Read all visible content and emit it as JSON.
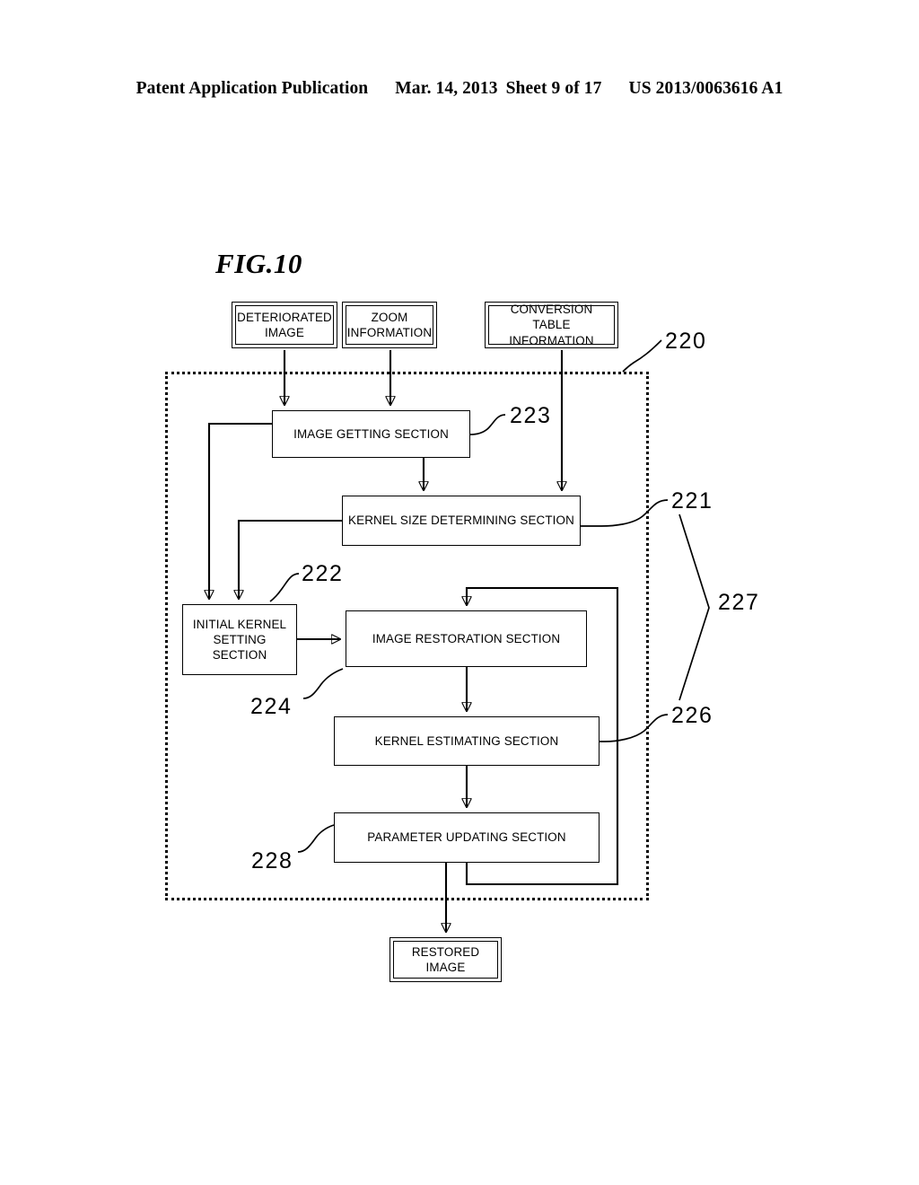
{
  "header": {
    "publication": "Patent Application Publication",
    "date": "Mar. 14, 2013",
    "sheet": "Sheet 9 of 17",
    "number": "US 2013/0063616 A1"
  },
  "figure": {
    "label": "FIG.10"
  },
  "inputs": [
    {
      "id": "deteriorated-image",
      "line1": "DETERIORATED",
      "line2": "IMAGE"
    },
    {
      "id": "zoom-information",
      "line1": "ZOOM",
      "line2": "INFORMATION"
    },
    {
      "id": "conversion-table-information",
      "line1": "CONVERSION",
      "line2": "TABLE INFORMATION"
    }
  ],
  "blocks": {
    "image_getting": "IMAGE GETTING SECTION",
    "kernel_size_determining": "KERNEL SIZE DETERMINING SECTION",
    "initial_kernel_setting_line1": "INITIAL KERNEL",
    "initial_kernel_setting_line2": "SETTING",
    "initial_kernel_setting_line3": "SECTION",
    "image_restoration": "IMAGE RESTORATION SECTION",
    "kernel_estimating": "KERNEL ESTIMATING SECTION",
    "parameter_updating": "PARAMETER UPDATING SECTION"
  },
  "output": {
    "line1": "RESTORED",
    "line2": "IMAGE"
  },
  "reference_numerals": {
    "enclosure": "220",
    "image_getting": "223",
    "kernel_size_determining": "221",
    "initial_kernel_setting": "222",
    "image_restoration": "224",
    "kernel_estimating": "226",
    "parameter_updating": "228",
    "bracket_group": "227"
  },
  "colors": {
    "ink": "#000000",
    "paper": "#ffffff"
  }
}
